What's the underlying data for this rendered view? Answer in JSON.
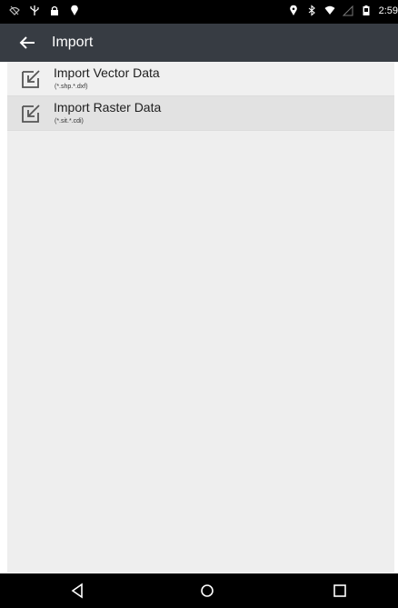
{
  "status_bar": {
    "time": "2:59",
    "left_icons": [
      "wifi-off-icon",
      "usb-icon",
      "lock-icon",
      "location-pin-icon"
    ],
    "right_icons": [
      "location-icon",
      "bluetooth-icon",
      "wifi-icon",
      "signal-icon",
      "battery-icon"
    ]
  },
  "app_bar": {
    "title": "Import",
    "back_icon": "arrow-back-icon"
  },
  "import_list": [
    {
      "title": "Import Vector Data",
      "subtitle": "(*.shp.*.dxf)",
      "icon": "import-icon"
    },
    {
      "title": "Import Raster Data",
      "subtitle": "(*.sit.*.cdi)",
      "icon": "import-icon"
    }
  ],
  "nav_bar": {
    "buttons": [
      "back-triangle-icon",
      "home-circle-icon",
      "recents-square-icon"
    ]
  },
  "colors": {
    "app_bar": "#373c43",
    "content_bg": "#eeeeee",
    "selected_row": "#e2e2e2",
    "status_bar": "#000000"
  }
}
